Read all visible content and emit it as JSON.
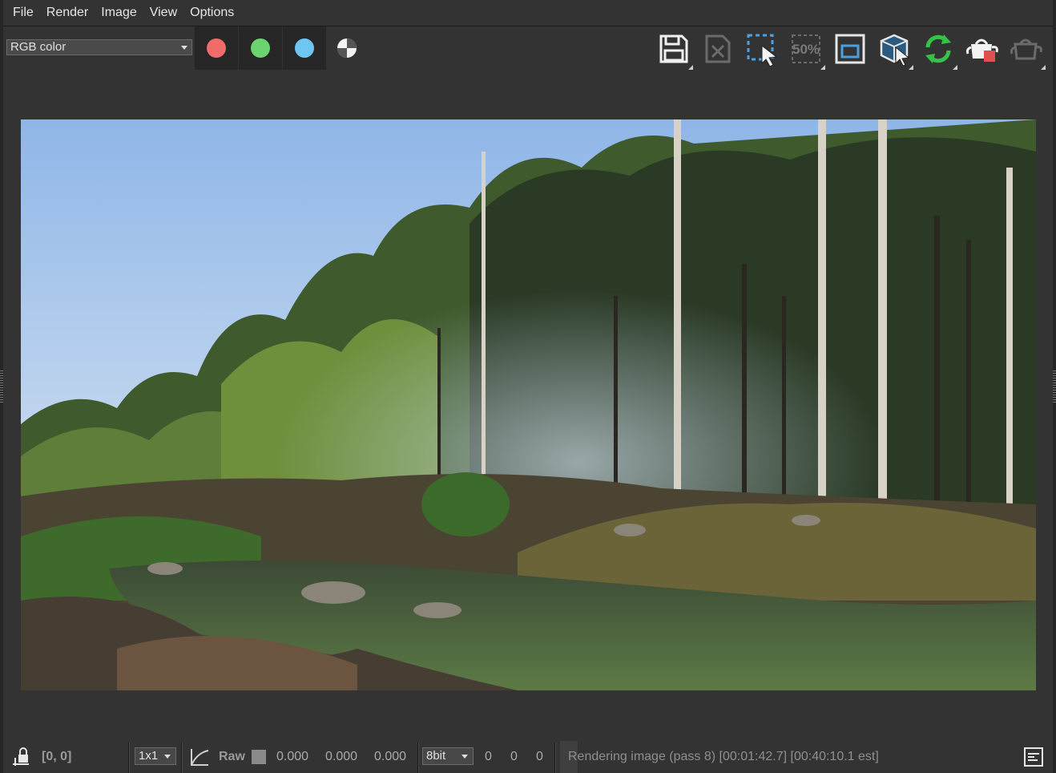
{
  "menu": {
    "items": [
      "File",
      "Render",
      "Image",
      "View",
      "Options"
    ]
  },
  "toolbar": {
    "channel_select_value": "RGB color",
    "channel_colors": {
      "red": "#f26b6b",
      "green": "#6bd46e",
      "blue": "#6fc6f5"
    },
    "icons": [
      "save-icon",
      "clear-image-icon",
      "region-render-icon",
      "zoom-50-icon",
      "track-mouse-icon",
      "render-region-cube-icon",
      "refresh-icon",
      "stop-render-teapot-icon",
      "render-teapot-icon"
    ],
    "zoom_label": "50%"
  },
  "statusbar": {
    "coords": "[0, 0]",
    "sample_size": "1x1",
    "color_mode": "Raw",
    "float_values": [
      "0.000",
      "0.000",
      "0.000"
    ],
    "bit_depth": "8bit",
    "int_values": [
      "0",
      "0",
      "0"
    ],
    "status_text": "Rendering image (pass 8) [00:01:42.7] [00:40:10.1 est]"
  },
  "colors": {
    "background": "#333333",
    "panel_dark": "#262626",
    "accent_green": "#36c246",
    "accent_blue": "#4aa0e0",
    "stop_red": "#e05050"
  }
}
